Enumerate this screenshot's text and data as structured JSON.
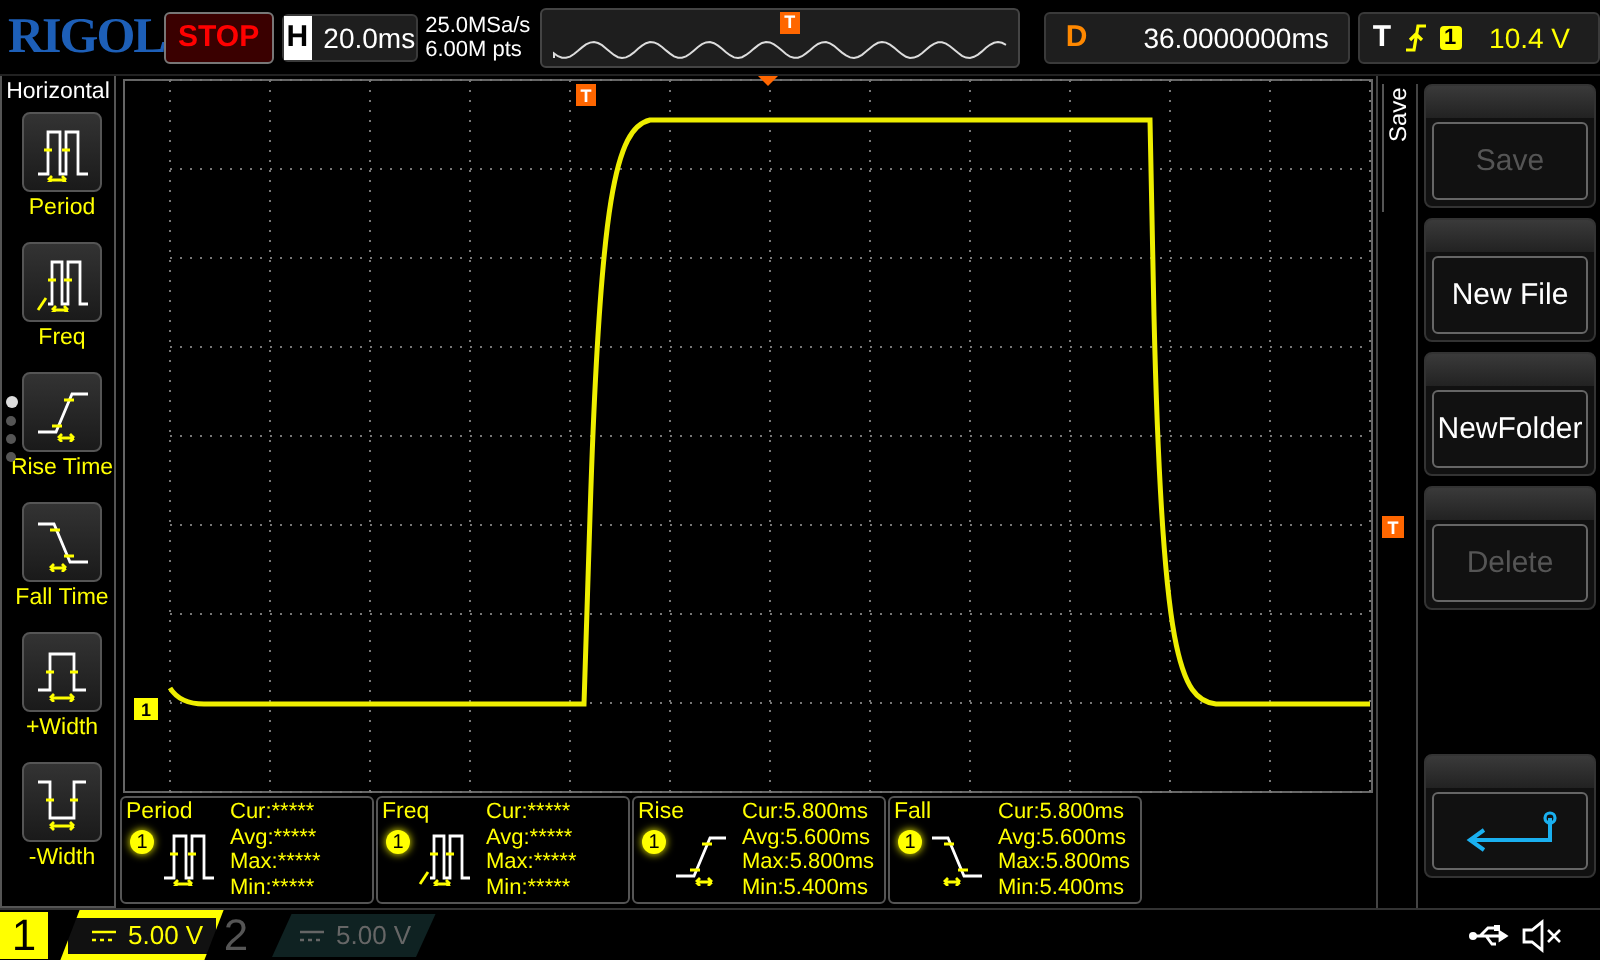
{
  "brand": "RIGOL",
  "run_state": "STOP",
  "timebase": {
    "label": "H",
    "value": "20.0ms"
  },
  "sample": {
    "rate": "25.0MSa/s",
    "depth": "6.00M pts"
  },
  "memory_trigger_marker": "T",
  "delay": {
    "label": "D",
    "value": "36.0000000ms"
  },
  "trigger": {
    "label": "T",
    "source": "1",
    "level": "10.4 V"
  },
  "side_menu": {
    "title": "Horizontal",
    "items": [
      {
        "label": "Period",
        "kind": "period"
      },
      {
        "label": "Freq",
        "kind": "freq"
      },
      {
        "label": "Rise Time",
        "kind": "rise"
      },
      {
        "label": "Fall Time",
        "kind": "fall"
      },
      {
        "label": "+Width",
        "kind": "pwidth"
      },
      {
        "label": "-Width",
        "kind": "nwidth"
      }
    ],
    "pages": [
      {
        "selected": true
      },
      {
        "selected": false
      },
      {
        "selected": false
      },
      {
        "selected": false
      }
    ]
  },
  "screen": {
    "channel_marker": "1",
    "trigger_time_marker": "T",
    "trigger_level_marker": "T"
  },
  "measurements": [
    {
      "name": "Period",
      "kind": "period",
      "channel": "1",
      "stats": [
        "Cur:*****",
        "Avg:*****",
        "Max:*****",
        "Min:*****"
      ]
    },
    {
      "name": "Freq",
      "kind": "freq",
      "channel": "1",
      "stats": [
        "Cur:*****",
        "Avg:*****",
        "Max:*****",
        "Min:*****"
      ]
    },
    {
      "name": "Rise",
      "kind": "rise",
      "channel": "1",
      "stats": [
        "Cur:5.800ms",
        "Avg:5.600ms",
        "Max:5.800ms",
        "Min:5.400ms"
      ]
    },
    {
      "name": "Fall",
      "kind": "fall",
      "channel": "1",
      "stats": [
        "Cur:5.800ms",
        "Avg:5.600ms",
        "Max:5.800ms",
        "Min:5.400ms"
      ]
    }
  ],
  "save_menu": {
    "title": "Save",
    "buttons": [
      {
        "label": "Save",
        "disabled": true
      },
      {
        "label": "New File",
        "disabled": false
      },
      {
        "label": "NewFolder",
        "disabled": false
      },
      {
        "label": "Delete",
        "disabled": true
      }
    ]
  },
  "channels": [
    {
      "number": "1",
      "scale": "5.00 V",
      "on": true
    },
    {
      "number": "2",
      "scale": "5.00 V",
      "on": false
    }
  ]
}
